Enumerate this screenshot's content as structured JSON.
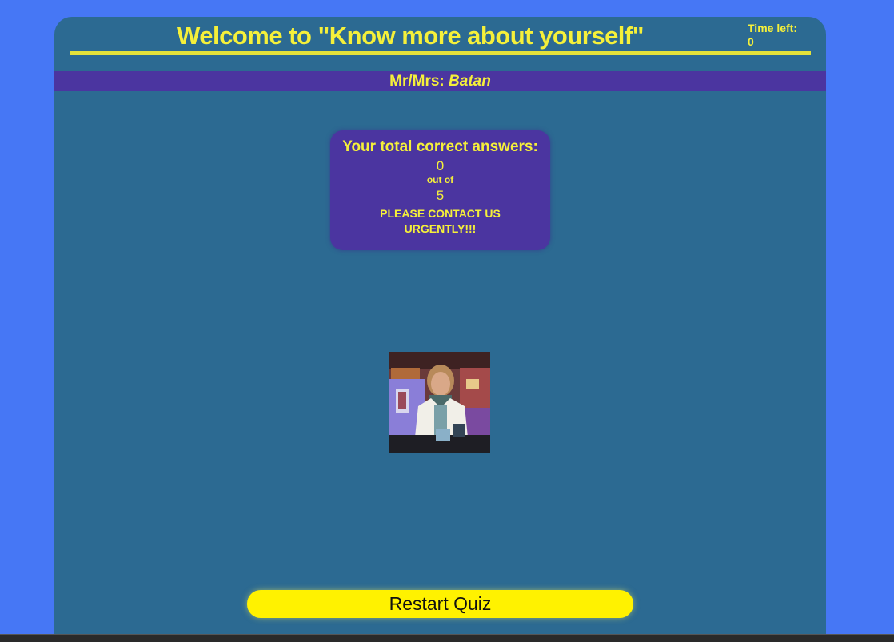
{
  "header": {
    "title": "Welcome to \"Know more about yourself\"",
    "time_label": "Time left:",
    "time_value": "0"
  },
  "user": {
    "prefix": "Mr/Mrs:",
    "name": "Batan"
  },
  "result": {
    "heading": "Your total correct answers:",
    "correct": "0",
    "out_of_label": "out of",
    "total": "5",
    "message_line1": "PLEASE CONTACT US",
    "message_line2": "URGENTLY!!!"
  },
  "actions": {
    "restart_label": "Restart Quiz"
  },
  "colors": {
    "page_bg": "#4677f5",
    "panel_bg": "#2c6a92",
    "accent_yellow": "#f5f03a",
    "purple": "#4b35a0",
    "button_yellow": "#fff200"
  }
}
